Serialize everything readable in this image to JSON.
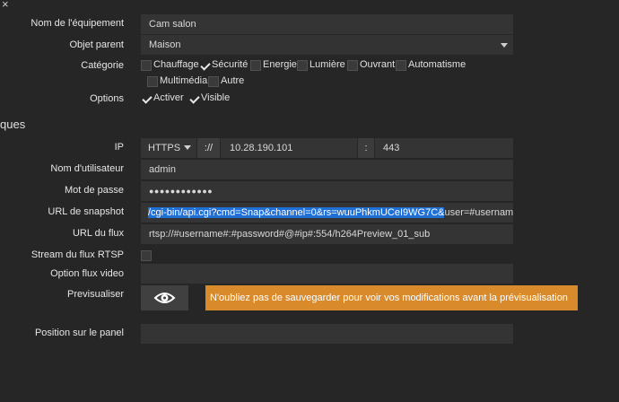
{
  "window": {
    "close_glyph": "×"
  },
  "section_title": "ques",
  "labels": {
    "name": "Nom de l'équipement",
    "parent": "Objet parent",
    "category": "Catégorie",
    "options": "Options",
    "ip": "IP",
    "username": "Nom d'utilisateur",
    "password": "Mot de passe",
    "snapshot_url": "URL de snapshot",
    "stream_url": "URL du flux",
    "rtsp": "Stream du flux RTSP",
    "video_option": "Option flux video",
    "preview": "Previsualiser",
    "panel_position": "Position sur le panel"
  },
  "fields": {
    "name": "Cam salon",
    "parent": "Maison",
    "protocol": "HTTPS",
    "protocol_sep": "://",
    "ip": "10.28.190.101",
    "port_sep": ":",
    "port": "443",
    "username": "admin",
    "password": "●●●●●●●●●●●●",
    "snapshot_selected": "/cgi-bin/api.cgi?cmd=Snap&channel=0&rs=wuuPhkmUCeI9WG7C&",
    "snapshot_rest": "user=#username#&passw",
    "stream_url": "rtsp://#username#:#password#@#ip#:554/h264Preview_01_sub",
    "video_option": "",
    "panel_position": ""
  },
  "categories": [
    {
      "label": "Chauffage",
      "checked": false
    },
    {
      "label": "Sécurité",
      "checked": true
    },
    {
      "label": "Energie",
      "checked": false
    },
    {
      "label": "Lumière",
      "checked": false
    },
    {
      "label": "Ouvrant",
      "checked": false
    },
    {
      "label": "Automatisme",
      "checked": false
    },
    {
      "label": "Multimédia",
      "checked": false
    },
    {
      "label": "Autre",
      "checked": false
    }
  ],
  "options": [
    {
      "label": "Activer",
      "checked": true
    },
    {
      "label": "Visible",
      "checked": true
    }
  ],
  "rtsp_checked": false,
  "preview": {
    "icon": "eye-icon",
    "warning": "N'oubliez pas de sauvegarder pour voir vos modifications avant la prévisualisation"
  },
  "colors": {
    "warning_bg": "#d98a2a",
    "selection_bg": "#1e6fd6"
  }
}
